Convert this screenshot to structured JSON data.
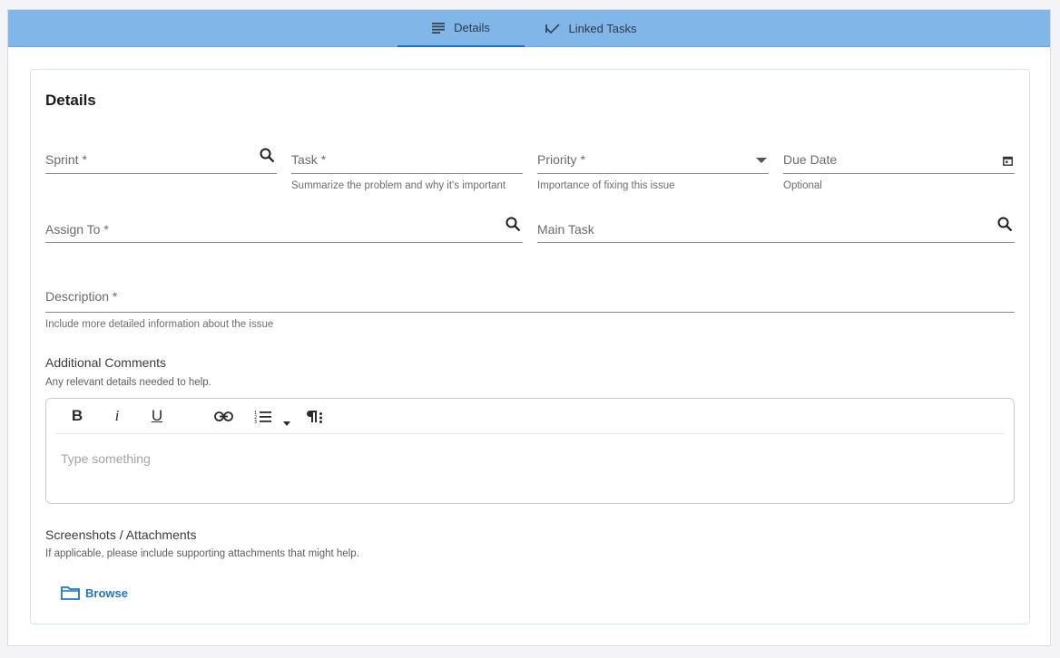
{
  "tabs": {
    "details": {
      "label": "Details",
      "icon": "notes-icon"
    },
    "linked": {
      "label": "Linked Tasks",
      "icon": "linked-tasks-icon"
    }
  },
  "form": {
    "title": "Details",
    "sprint": {
      "label": "Sprint *",
      "icon": "search-icon"
    },
    "task": {
      "label": "Task *",
      "hint": "Summarize the problem and why it's important"
    },
    "priority": {
      "label": "Priority *",
      "hint": "Importance of fixing this issue",
      "icon": "dropdown-arrow-icon"
    },
    "due_date": {
      "label": "Due Date",
      "hint": "Optional",
      "icon": "calendar-icon"
    },
    "assign_to": {
      "label": "Assign To *",
      "icon": "search-icon"
    },
    "main_task": {
      "label": "Main Task",
      "icon": "search-icon"
    },
    "description": {
      "label": "Description *",
      "hint": "Include more detailed information about the issue"
    },
    "comments": {
      "heading": "Additional Comments",
      "hint": "Any relevant details needed to help.",
      "placeholder": "Type something",
      "toolbar": {
        "bold": "B",
        "italic": "i",
        "underline": "U"
      }
    },
    "attachments": {
      "heading": "Screenshots / Attachments",
      "hint": "If applicable, please include supporting attachments that might help.",
      "browse_label": "Browse"
    }
  },
  "colors": {
    "tabbar": "#80b6e8",
    "accent": "#1f74c7"
  }
}
